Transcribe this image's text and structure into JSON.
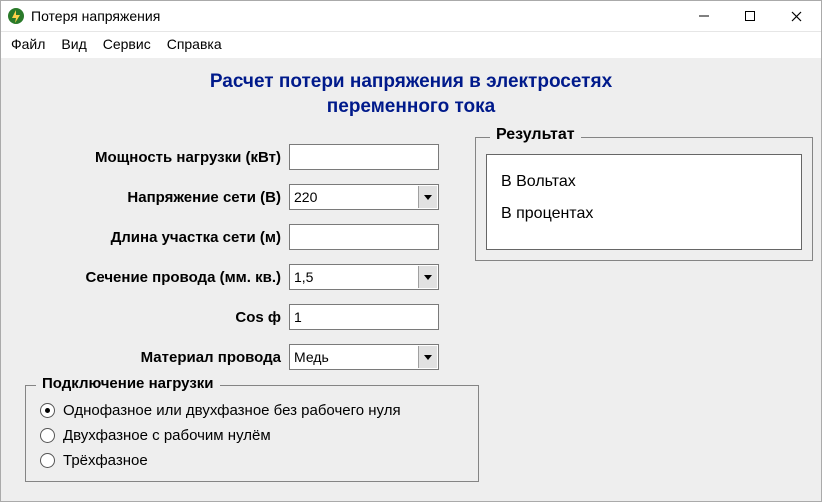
{
  "window": {
    "title": "Потеря напряжения"
  },
  "menu": {
    "file": "Файл",
    "view": "Вид",
    "service": "Сервис",
    "help": "Справка"
  },
  "heading": {
    "line1": "Расчет потери напряжения в электросетях",
    "line2": "переменного тока"
  },
  "form": {
    "power_label": "Мощность нагрузки (кВт)",
    "power_value": "",
    "voltage_label": "Напряжение сети (В)",
    "voltage_value": "220",
    "length_label": "Длина участка сети (м)",
    "length_value": "",
    "section_label": "Сечение провода (мм. кв.)",
    "section_value": "1,5",
    "cos_label": "Cos ф",
    "cos_value": "1",
    "material_label": "Материал провода",
    "material_value": "Медь"
  },
  "connection": {
    "legend": "Подключение нагрузки",
    "opt1": "Однофазное или  двухфазное без рабочего нуля",
    "opt2": "Двухфазное с рабочим нулём",
    "opt3": "Трёхфазное"
  },
  "result": {
    "legend": "Результат",
    "volts_label": "В Вольтах",
    "percent_label": "В процентах"
  }
}
